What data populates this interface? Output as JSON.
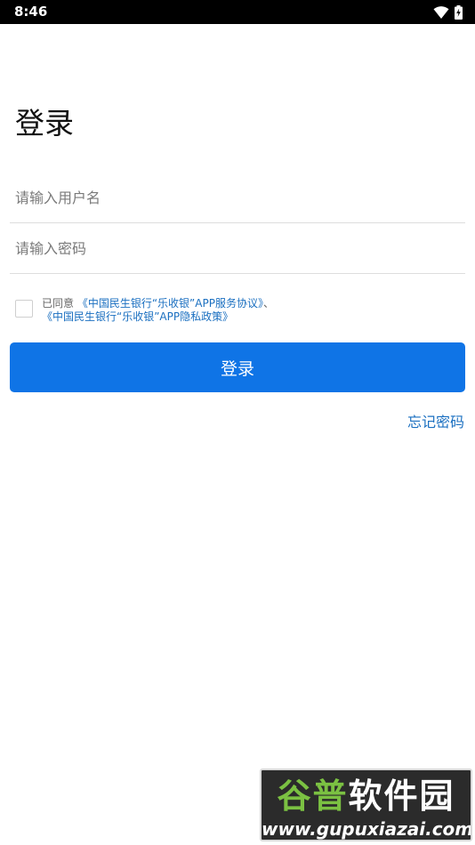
{
  "status_bar": {
    "time": "8:46",
    "icons": [
      "wifi-icon",
      "battery-charging-icon"
    ]
  },
  "login": {
    "title": "登录",
    "username_placeholder": "请输入用户名",
    "password_placeholder": "请输入密码",
    "agreement": {
      "prefix": "已同意",
      "service_link": "《中国民生银行“乐收银”APP服务协议》",
      "separator": "、",
      "privacy_link": "《中国民生银行“乐收银”APP隐私政策》"
    },
    "submit_label": "登录",
    "forgot_password": "忘记密码"
  },
  "watermark": {
    "title_part1": "谷普",
    "title_part2": "软件园",
    "url": "www.gupuxiazai.com"
  },
  "colors": {
    "primary": "#0f74e6",
    "link": "#1a6fc0",
    "status_bar": "#000000"
  }
}
